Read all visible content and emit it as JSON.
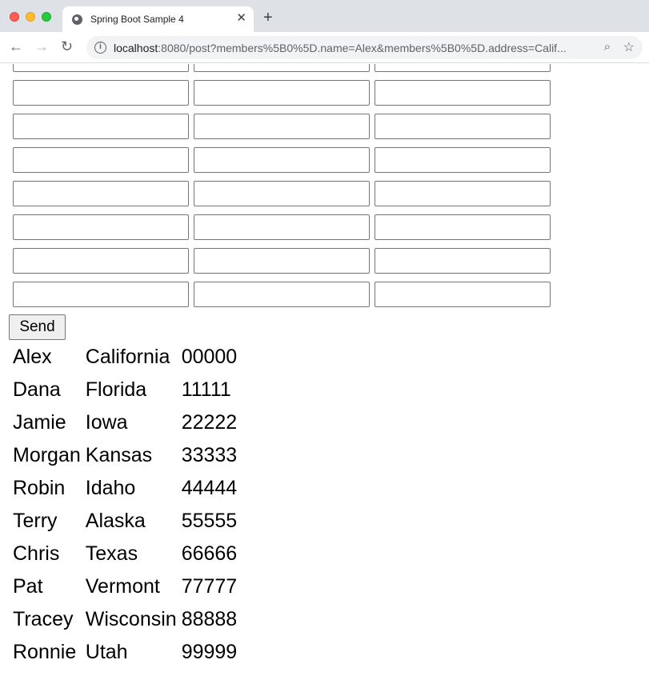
{
  "browser": {
    "tab_title": "Spring Boot Sample 4",
    "tab_close": "✕",
    "new_tab": "+",
    "url_host": "localhost",
    "url_rest": ":8080/post?members%5B0%5D.name=Alex&members%5B0%5D.address=Calif..."
  },
  "form": {
    "send_label": "Send"
  },
  "members": [
    {
      "name": "Alex",
      "address": "California",
      "zip": "00000"
    },
    {
      "name": "Dana",
      "address": "Florida",
      "zip": "11111"
    },
    {
      "name": "Jamie",
      "address": "Iowa",
      "zip": "22222"
    },
    {
      "name": "Morgan",
      "address": "Kansas",
      "zip": "33333"
    },
    {
      "name": "Robin",
      "address": "Idaho",
      "zip": "44444"
    },
    {
      "name": "Terry",
      "address": "Alaska",
      "zip": "55555"
    },
    {
      "name": "Chris",
      "address": "Texas",
      "zip": "66666"
    },
    {
      "name": "Pat",
      "address": "Vermont",
      "zip": "77777"
    },
    {
      "name": "Tracey",
      "address": "Wisconsin",
      "zip": "88888"
    },
    {
      "name": "Ronnie",
      "address": "Utah",
      "zip": "99999"
    }
  ]
}
